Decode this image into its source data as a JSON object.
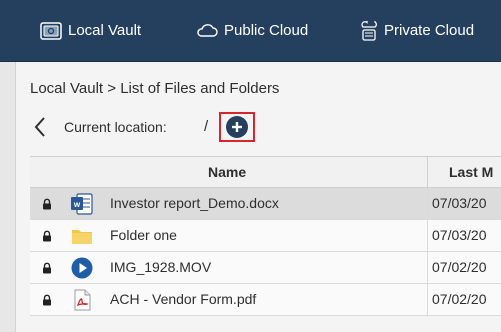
{
  "nav": {
    "tabs": [
      {
        "label": "Local Vault",
        "icon": "vault-icon"
      },
      {
        "label": "Public Cloud",
        "icon": "cloud-icon"
      },
      {
        "label": "Private Cloud",
        "icon": "private-cloud-icon"
      }
    ]
  },
  "breadcrumb": "Local Vault > List of Files and Folders",
  "location": {
    "label": "Current location:",
    "path": "/",
    "add_icon": "plus-icon"
  },
  "table": {
    "columns": [
      "Name",
      "Last M"
    ],
    "rows": [
      {
        "name": "Investor report_Demo.docx",
        "date": "07/03/20",
        "type": "word-document",
        "selected": true
      },
      {
        "name": "Folder one",
        "date": "07/03/20",
        "type": "folder",
        "selected": false
      },
      {
        "name": "IMG_1928.MOV",
        "date": "07/02/20",
        "type": "video",
        "selected": false
      },
      {
        "name": "ACH - Vendor Form.pdf",
        "date": "07/02/20",
        "type": "pdf",
        "selected": false
      }
    ]
  },
  "colors": {
    "nav_bg": "#25405f",
    "selected_row": "#dcdcdc",
    "highlight_border": "#d8252e",
    "word_blue": "#2b5797",
    "folder_yellow": "#f3c64a",
    "video_blue": "#1f5fa8",
    "pdf_red": "#cf2a2a"
  }
}
